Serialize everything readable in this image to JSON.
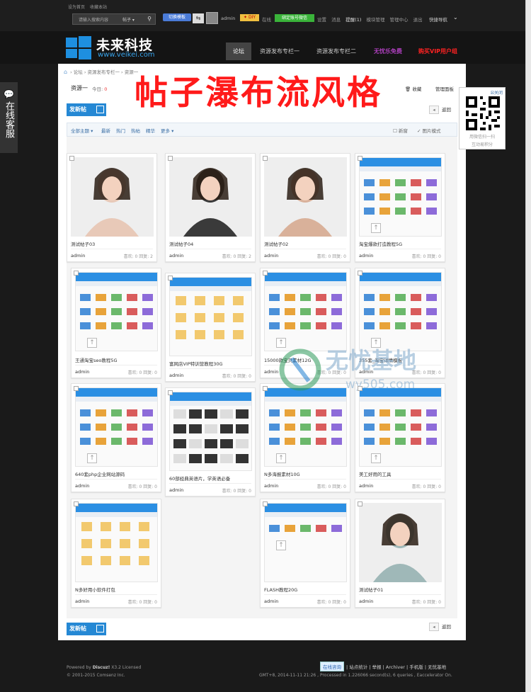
{
  "topbar": {
    "links": [
      "设为首页",
      "收藏本站"
    ],
    "search_placeholder": "请输入搜索内容",
    "search_scope": "帖子",
    "switch_template": "切换模板",
    "username": "admin",
    "diy": "DIY",
    "online": "在线",
    "wechat_bind": "绑定账号微信",
    "menu": [
      "设置",
      "消息",
      "提醒(1)",
      "模块管理",
      "管理中心",
      "退出"
    ],
    "quicknav": "快捷导航"
  },
  "header": {
    "logo_title": "未来科技",
    "logo_url": "www.veikei.com",
    "nav": [
      "论坛",
      "资源发布专栏一",
      "资源发布专栏二",
      "无忧乐免费",
      "购买VIP用户组"
    ]
  },
  "sidebar": {
    "customer_service": "在线客服"
  },
  "breadcrumb": [
    "论坛",
    "资源发布专栏一",
    "资源一"
  ],
  "forum": {
    "name": "资源一",
    "today_label": "今日:",
    "today_count": "0",
    "overlay_title": "帖子瀑布流风格",
    "favorite": "收藏",
    "manage": "管理面板",
    "new_post": "发新帖",
    "back": "返回"
  },
  "filters": {
    "items": [
      "全部主题",
      "最新",
      "热门",
      "热帖",
      "精华",
      "更多"
    ],
    "new_window": "新窗",
    "image_mode": "图片模式"
  },
  "posts": [
    {
      "title": "测试帖子03",
      "author": "admin",
      "likes": "喜欢: 0",
      "replies": "回复: 2",
      "kind": "photo",
      "color": "#e8c9b8"
    },
    {
      "title": "测试帖子04",
      "author": "admin",
      "likes": "喜欢: 0",
      "replies": "回复: 2",
      "kind": "photo",
      "color": "#3a3a3a"
    },
    {
      "title": "测试帖子02",
      "author": "admin",
      "likes": "喜欢: 0",
      "replies": "回复: 0",
      "kind": "photo",
      "color": "#d9b19a"
    },
    {
      "title": "淘宝爆款打造教程5G",
      "author": "admin",
      "likes": "喜欢: 0",
      "replies": "回复: 0",
      "kind": "shot"
    },
    {
      "title": "王通淘宝seo教程5G",
      "author": "admin",
      "likes": "喜欢: 0",
      "replies": "回复: 0",
      "kind": "shot"
    },
    {
      "title": "富网店VIP特训营教程30G",
      "author": "admin",
      "likes": "喜欢: 0",
      "replies": "回复: 0",
      "kind": "folders"
    },
    {
      "title": "15000款宝贝素材12G",
      "author": "admin",
      "likes": "喜欢: 0",
      "replies": "回复: 0",
      "kind": "shot"
    },
    {
      "title": "355套_淘宝详情模板",
      "author": "admin",
      "likes": "喜欢: 0",
      "replies": "回复: 0",
      "kind": "shot"
    },
    {
      "title": "640套php企业网站源码",
      "author": "admin",
      "likes": "喜欢: 0",
      "replies": "回复: 0",
      "kind": "shot"
    },
    {
      "title": "60部经典英语片，学英语必备",
      "author": "admin",
      "likes": "喜欢: 0",
      "replies": "回复: 0",
      "kind": "video"
    },
    {
      "title": "N多海报素材10G",
      "author": "admin",
      "likes": "喜欢: 0",
      "replies": "回复: 0",
      "kind": "shot"
    },
    {
      "title": "美工好用的工具",
      "author": "admin",
      "likes": "喜欢: 0",
      "replies": "回复: 0",
      "kind": "shot"
    },
    {
      "title": "N多好用小软件打包",
      "author": "admin",
      "likes": "喜欢: 0",
      "replies": "回复: 0",
      "kind": "folders"
    },
    {
      "title": "FLASH教程20G",
      "author": "admin",
      "likes": "喜欢: 0",
      "replies": "回复: 0",
      "kind": "shot2"
    },
    {
      "title": "测试帖子01",
      "author": "admin",
      "likes": "喜欢: 0",
      "replies": "回复: 0",
      "kind": "photo",
      "color": "#9fb8b8"
    }
  ],
  "watermark": {
    "cn": "无忧基地",
    "url": "wy505.com"
  },
  "qr": {
    "close": "关闭",
    "line1": "用微信扫一扫",
    "line2": "互动易积分"
  },
  "footer": {
    "powered": "Powered by",
    "brand": "Discuz!",
    "version": "X3.2",
    "license": "Licensed",
    "copyright": "© 2001-2015 Comsenz Inc.",
    "online_cs": "在线咨询",
    "links": [
      "站点统计",
      "举报",
      "Archiver",
      "手机版",
      "无忧基地"
    ],
    "stats": "GMT+8, 2014-11-11 21:26 , Processed in 1.226066 second(s), 6 queries , Eaccelerator On."
  }
}
